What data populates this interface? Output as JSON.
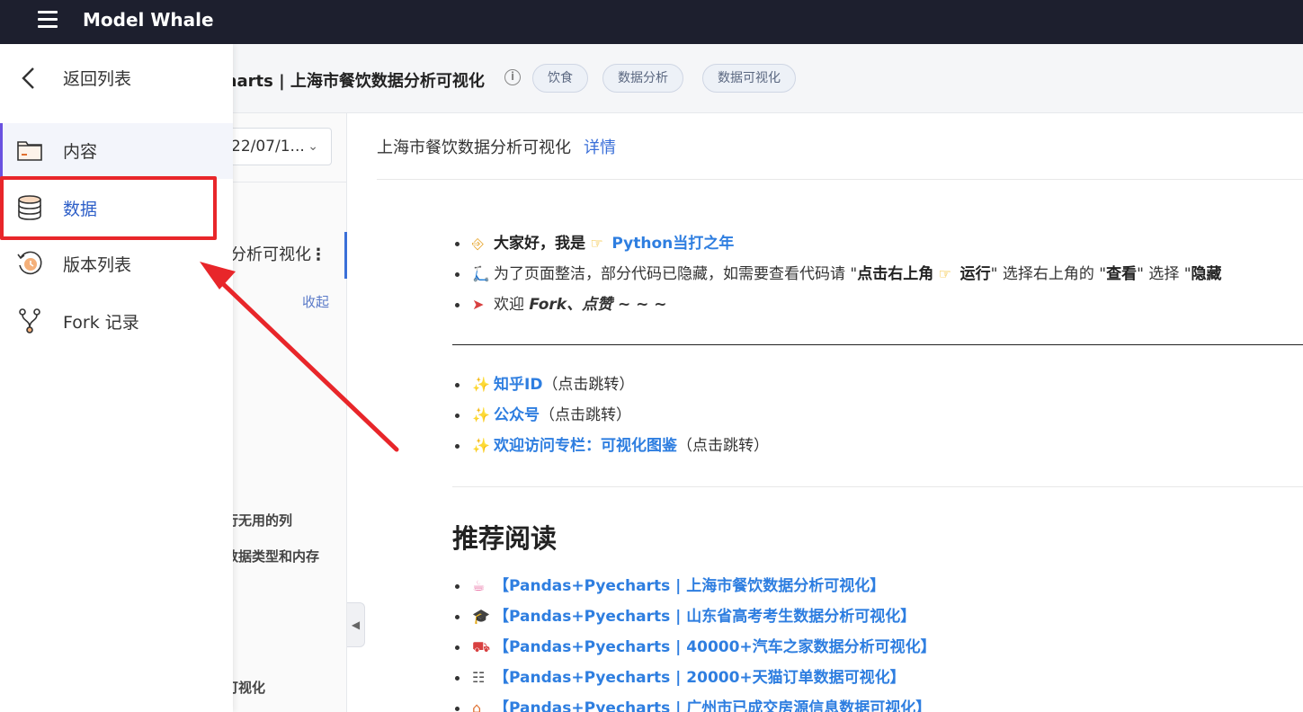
{
  "app": {
    "brand": "Model Whale"
  },
  "project": {
    "title": "charts | 上海市餐饮数据分析可视化",
    "tags": [
      "饮食",
      "数据分析",
      "数据可视化"
    ]
  },
  "sidebar": {
    "back_label": "返回列表",
    "items": [
      {
        "label": "内容",
        "icon": "window-icon"
      },
      {
        "label": "数据",
        "icon": "database-icon"
      },
      {
        "label": "版本列表",
        "icon": "history-clock-icon"
      },
      {
        "label": "Fork 记录",
        "icon": "fork-icon"
      }
    ]
  },
  "middle": {
    "version_value": "22/07/1...",
    "doc_item_label": "分析可视化",
    "collapse_label": "收起",
    "toc_items": [
      "行无用的列",
      "数据类型和内存",
      "可视化"
    ]
  },
  "content": {
    "head_title": "上海市餐饮数据分析可视化",
    "details_link": "详情",
    "intro": {
      "line1_prefix": "大家好，我是",
      "line1_link": "Python当打之年",
      "line2_a": "为了页面整洁，部分代码已隐藏，如需要查看代码请 \"",
      "line2_b": "点击右上角",
      "line2_c": "运行",
      "line2_d": "\" 选择右上角的 \"",
      "line2_e": "查看",
      "line2_f": "\" 选择 \"",
      "line2_g": "隐藏",
      "line3_prefix": "欢迎",
      "line3_em": "Fork、点赞 ~ ~ ~"
    },
    "links": [
      {
        "label": "知乎ID",
        "suffix": "（点击跳转）"
      },
      {
        "label": "公众号",
        "suffix": "（点击跳转）"
      },
      {
        "label": "欢迎访问专栏：可视化图鉴",
        "suffix": "（点击跳转）"
      }
    ],
    "recommend_title": "推荐阅读",
    "recommend": [
      "【Pandas+Pyecharts | 上海市餐饮数据分析可视化】",
      "【Pandas+Pyecharts | 山东省高考考生数据分析可视化】",
      "【Pandas+Pyecharts | 40000+汽车之家数据分析可视化】",
      "【Pandas+Pyecharts | 20000+天猫订单数据可视化】",
      "【Pandas+Pyecharts | 广州市已成交房源信息数据可视化】"
    ]
  },
  "colors": {
    "accent": "#3a6fd8",
    "annotation": "#e8262a",
    "topbar": "#1d1f2e"
  }
}
